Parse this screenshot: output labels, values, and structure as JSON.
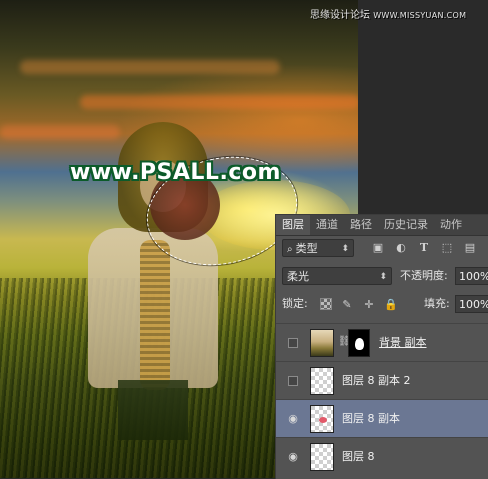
{
  "watermark": "www.PSALL.com",
  "site_tag": {
    "name": "思缘设计论坛",
    "domain": "WWW.MISSYUAN.COM"
  },
  "layers_panel": {
    "tabs": [
      {
        "label": "图层",
        "active": true
      },
      {
        "label": "通道",
        "active": false
      },
      {
        "label": "路径",
        "active": false
      },
      {
        "label": "历史记录",
        "active": false
      },
      {
        "label": "动作",
        "active": false
      }
    ],
    "filter": {
      "value": "类型",
      "icons": [
        "image-filter-icon",
        "adjustment-filter-icon",
        "type-filter-icon",
        "shape-filter-icon",
        "smart-object-filter-icon"
      ]
    },
    "blend_mode": "柔光",
    "opacity": {
      "label": "不透明度:",
      "value": "100%"
    },
    "lock": {
      "label": "锁定:"
    },
    "fill": {
      "label": "填充:",
      "value": "100%"
    },
    "layers": [
      {
        "name": "背景 副本",
        "visible": false,
        "selected": false,
        "has_mask": true
      },
      {
        "name": "图层 8 副本 2",
        "visible": false,
        "selected": false,
        "has_mask": false
      },
      {
        "name": "图层 8 副本",
        "visible": true,
        "selected": true,
        "has_mask": false
      },
      {
        "name": "图层 8",
        "visible": true,
        "selected": false,
        "has_mask": false
      }
    ],
    "colors": {
      "panel_bg": "#535353",
      "selected_row": "#6b7793",
      "tab_bar": "#424242"
    }
  }
}
